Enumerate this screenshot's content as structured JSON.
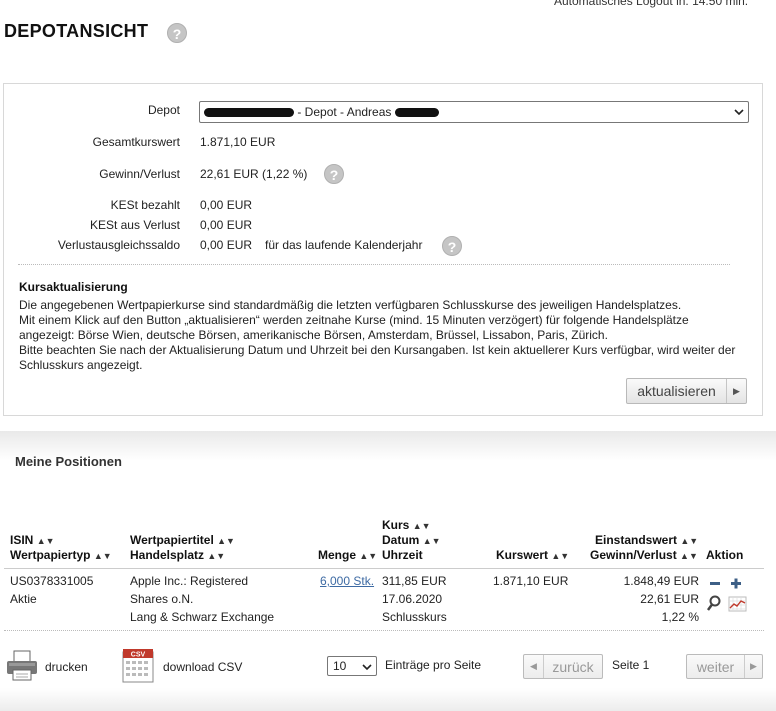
{
  "header": {
    "logout_note": "Automatisches Logout in: 14:50 min.",
    "title": "DEPOTANSICHT"
  },
  "summary": {
    "depot_label": "Depot",
    "depot_value_visible": "- Depot - Andreas",
    "gesamtkurswert_label": "Gesamtkurswert",
    "gesamtkurswert_value": "1.871,10 EUR",
    "gewinn_label": "Gewinn/Verlust",
    "gewinn_value": "22,61 EUR (1,22 %)",
    "kest_bezahlt_label": "KESt bezahlt",
    "kest_bezahlt_value": "0,00 EUR",
    "kest_verlust_label": "KESt aus Verlust",
    "kest_verlust_value": "0,00 EUR",
    "verlust_saldo_label": "Verlustausgleichssaldo",
    "verlust_saldo_value": "0,00 EUR",
    "verlust_saldo_note": "für das laufende Kalenderjahr"
  },
  "info": {
    "heading": "Kursaktualisierung",
    "line1": "Die angegebenen Wertpapierkurse sind standardmäßig die letzten verfügbaren Schlusskurse des jeweiligen Handelsplatzes.",
    "line2": "Mit einem Klick auf den Button „aktualisieren“ werden zeitnahe Kurse (mind. 15 Minuten verzögert) für folgende Handelsplätze angezeigt: Börse Wien, deutsche Börsen, amerikanische Börsen, Amsterdam, Brüssel, Lissabon, Paris, Zürich.",
    "line3": "Bitte beachten Sie nach der Aktualisierung Datum und Uhrzeit bei den Kursangaben. Ist kein aktuellerer Kurs verfügbar, wird weiter der Schlusskurs angezeigt.",
    "refresh_button": "aktualisieren"
  },
  "positions": {
    "heading": "Meine Positionen",
    "columns": {
      "isin": "ISIN",
      "wertpapiertyp": "Wertpapiertyp",
      "wertpapiertitel": "Wertpapiertitel",
      "handelsplatz": "Handelsplatz",
      "menge": "Menge",
      "kurs": "Kurs",
      "datum": "Datum",
      "uhrzeit": "Uhrzeit",
      "kurswert": "Kurswert",
      "einstandswert": "Einstandswert",
      "gewinn": "Gewinn/Verlust",
      "aktion": "Aktion"
    },
    "rows": [
      {
        "isin": "US0378331005",
        "typ": "Aktie",
        "titel1": "Apple Inc.: Registered",
        "titel2": "Shares o.N.",
        "handelsplatz": "Lang & Schwarz Exchange",
        "menge": "6,000 Stk.",
        "kurs": "311,85 EUR",
        "datum": "17.06.2020",
        "uhrzeit": "Schlusskurs",
        "kurswert": "1.871,10 EUR",
        "einstandswert": "1.848,49 EUR",
        "gewinn": "22,61 EUR",
        "gewinn_pct": "1,22 %"
      }
    ]
  },
  "footer": {
    "print_label": "drucken",
    "csv_label": "download CSV",
    "csv_icon_text": "CSV",
    "per_page_value": "10",
    "per_page_label": "Einträge pro Seite",
    "prev_label": "zurück",
    "page_label": "Seite 1",
    "next_label": "weiter"
  }
}
